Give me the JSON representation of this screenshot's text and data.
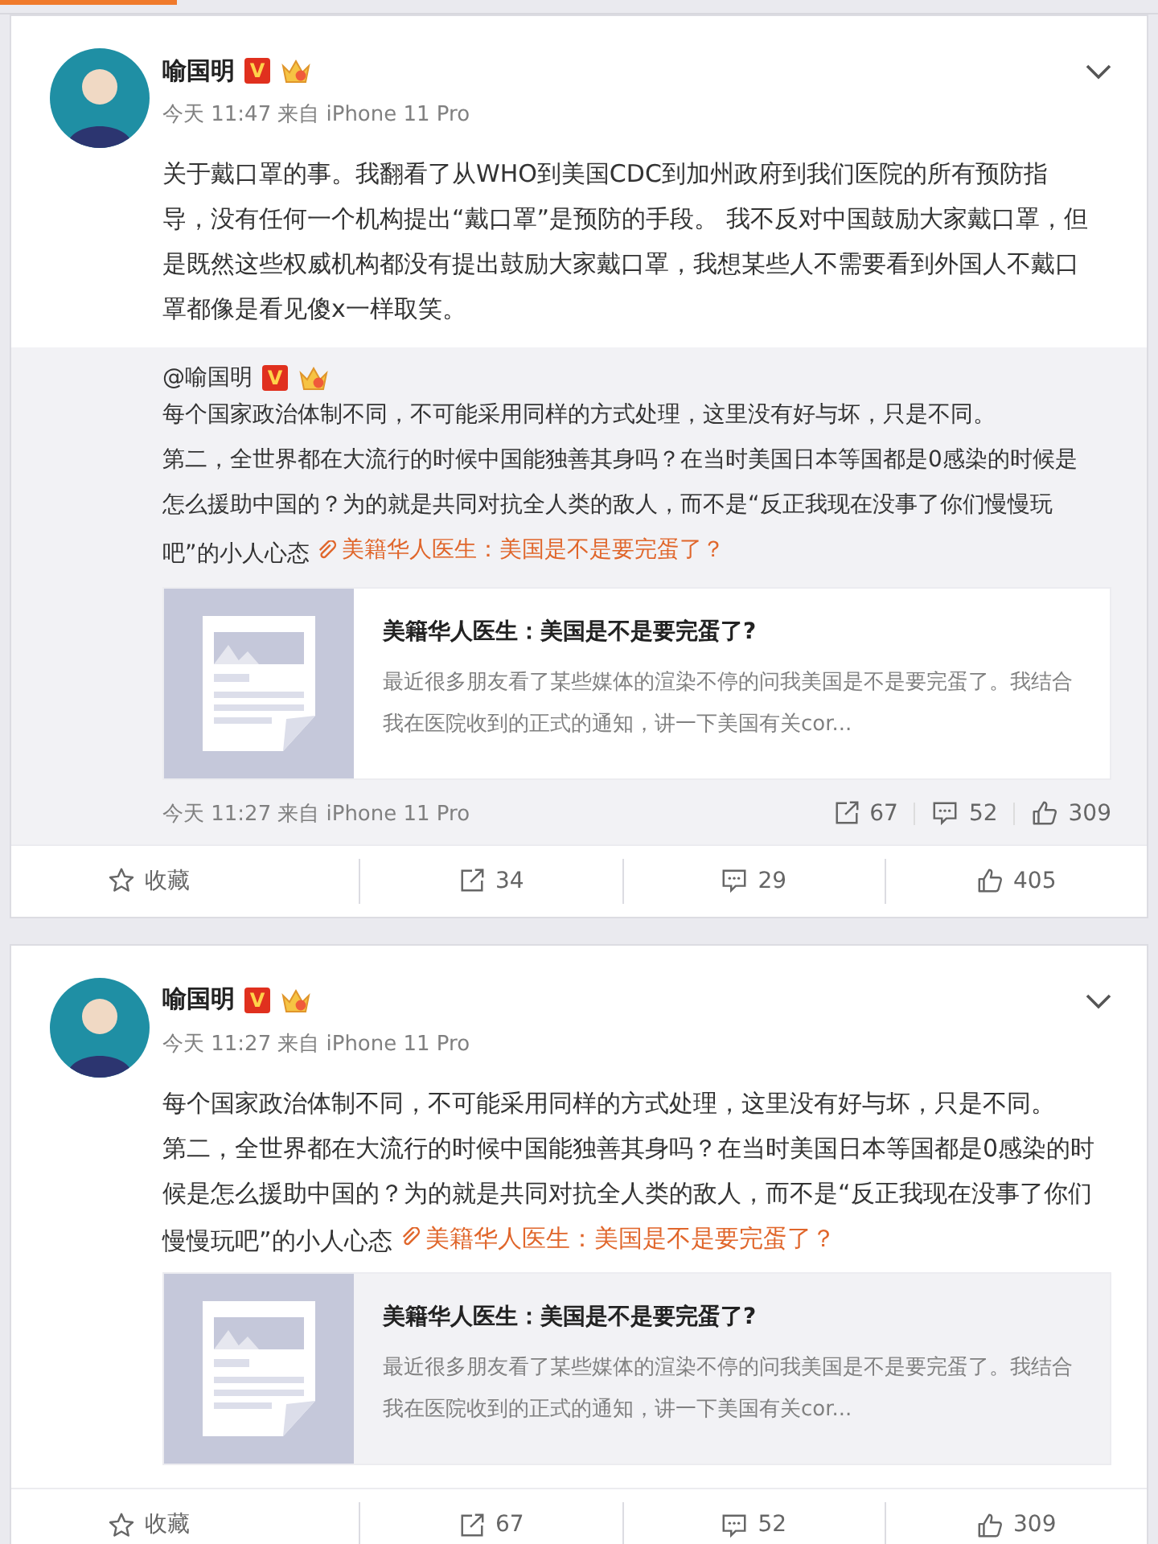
{
  "tab_strip": {
    "selected": true
  },
  "posts": [
    {
      "author": "喻国明",
      "badge": "V",
      "time": "今天 11:47",
      "source": "来自 iPhone 11 Pro",
      "paragraphs": [
        "关于戴口罩的事。我翻看了从WHO到美国CDC到加州政府到我们医院的所有预防指导，没有任何一个机构提出“戴口罩”是预防的手段。 我不反对中国鼓励大家戴口罩，但是既然这些权威机构都没有提出鼓励大家戴口罩，我想某些人不需要看到外国人不戴口罩都像是看见傻x一样取笑。"
      ],
      "retweet": {
        "author": "@喻国明",
        "badge": "V",
        "paragraphs": [
          "每个国家政治体制不同，不可能采用同样的方式处理，这里没有好与坏，只是不同。",
          "第二，全世界都在大流行的时候中国能独善其身吗？在当时美国日本等国都是0感染的时候是怎么援助中国的？为的就是共同对抗全人类的敌人，而不是“反正我现在没事了你们慢慢玩吧”的小人心态"
        ],
        "link": "美籍华人医生：美国是不是要完蛋了？",
        "article": {
          "title": "美籍华人医生：美国是不是要完蛋了?",
          "summary": "最近很多朋友看了某些媒体的渲染不停的问我美国是不是要完蛋了。我结合我在医院收到的正式的通知，讲一下美国有关cor..."
        },
        "time": "今天 11:27",
        "source": "来自 iPhone 11 Pro",
        "reposts": "67",
        "comments": "52",
        "likes": "309"
      },
      "actions": {
        "favorite": "收藏",
        "reposts": "34",
        "comments": "29",
        "likes": "405"
      }
    },
    {
      "author": "喻国明",
      "badge": "V",
      "time": "今天 11:27",
      "source": "来自 iPhone 11 Pro",
      "paragraphs": [
        "每个国家政治体制不同，不可能采用同样的方式处理，这里没有好与坏，只是不同。",
        "第二，全世界都在大流行的时候中国能独善其身吗？在当时美国日本等国都是0感染的时候是怎么援助中国的？为的就是共同对抗全人类的敌人，而不是“反正我现在没事了你们慢慢玩吧”的小人心态"
      ],
      "link": "美籍华人医生：美国是不是要完蛋了？",
      "article": {
        "title": "美籍华人医生：美国是不是要完蛋了?",
        "summary": "最近很多朋友看了某些媒体的渲染不停的问我美国是不是要完蛋了。我结合我在医院收到的正式的通知，讲一下美国有关cor..."
      },
      "actions": {
        "favorite": "收藏",
        "reposts": "67",
        "comments": "52",
        "likes": "309"
      }
    }
  ]
}
